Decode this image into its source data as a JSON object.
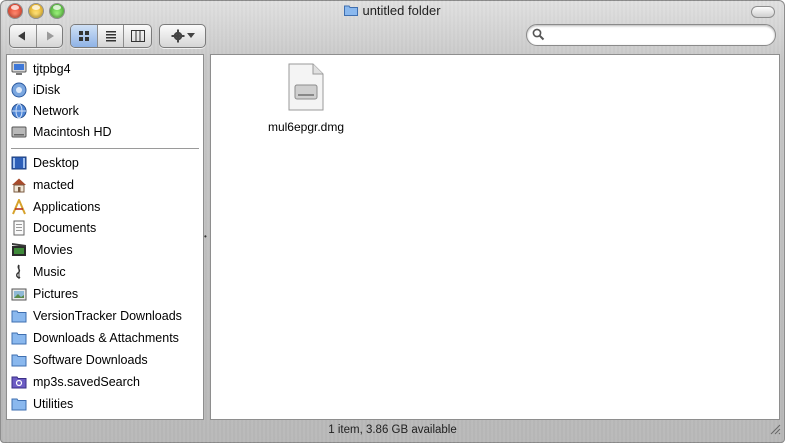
{
  "window": {
    "title": "untitled folder",
    "status_text": "1 item, 3.86 GB available"
  },
  "toolbar": {
    "back_icon": "back-arrow-icon",
    "forward_icon": "forward-arrow-icon",
    "view_modes": [
      "icon-view",
      "list-view",
      "column-view"
    ],
    "active_view": "icon-view",
    "action_icon": "gear-icon"
  },
  "search": {
    "placeholder": "",
    "value": ""
  },
  "sidebar": {
    "devices": [
      {
        "label": "tjtpbg4",
        "icon": "computer-icon"
      },
      {
        "label": "iDisk",
        "icon": "idisk-icon"
      },
      {
        "label": "Network",
        "icon": "network-icon"
      },
      {
        "label": "Macintosh HD",
        "icon": "hard-drive-icon"
      }
    ],
    "places": [
      {
        "label": "Desktop",
        "icon": "desktop-icon"
      },
      {
        "label": "macted",
        "icon": "home-icon"
      },
      {
        "label": "Applications",
        "icon": "applications-icon"
      },
      {
        "label": "Documents",
        "icon": "documents-icon"
      },
      {
        "label": "Movies",
        "icon": "movies-icon"
      },
      {
        "label": "Music",
        "icon": "music-icon"
      },
      {
        "label": "Pictures",
        "icon": "pictures-icon"
      },
      {
        "label": "VersionTracker Downloads",
        "icon": "folder-icon"
      },
      {
        "label": "Downloads & Attachments",
        "icon": "folder-icon"
      },
      {
        "label": "Software Downloads",
        "icon": "folder-icon"
      },
      {
        "label": "mp3s.savedSearch",
        "icon": "smart-folder-icon"
      },
      {
        "label": "Utilities",
        "icon": "folder-icon"
      }
    ]
  },
  "files": [
    {
      "name": "mul6epgr.dmg",
      "icon": "disk-image-icon"
    }
  ],
  "colors": {
    "selected_view": "#8fb3e6",
    "folder_blue": "#7fb0e8"
  }
}
